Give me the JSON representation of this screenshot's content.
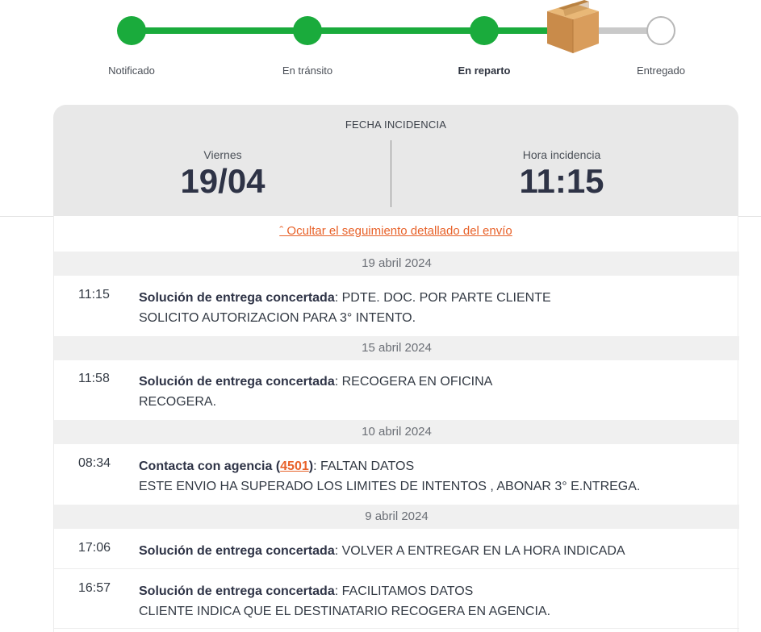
{
  "tracker": {
    "steps": [
      {
        "label": "Notificado",
        "state": "done"
      },
      {
        "label": "En tránsito",
        "state": "done"
      },
      {
        "label": "En reparto",
        "state": "current"
      },
      {
        "label": "Entregado",
        "state": "pending"
      }
    ],
    "accent": "#1aab3c",
    "icon": "package-box-icon"
  },
  "incident": {
    "title": "FECHA INCIDENCIA",
    "day_name": "Viernes",
    "date": "19/04",
    "time_label": "Hora incidencia",
    "time": "11:15"
  },
  "toggle_link": "ˆ Ocultar el seguimiento detallado del envío",
  "groups": [
    {
      "date": "19 abril 2024",
      "events": [
        {
          "time": "11:15",
          "title": "Solución de entrega concertada",
          "line1": ": PDTE. DOC. POR PARTE CLIENTE",
          "line2": "SOLICITO AUTORIZACION PARA 3° INTENTO."
        }
      ]
    },
    {
      "date": "15 abril 2024",
      "events": [
        {
          "time": "11:58",
          "title": "Solución de entrega concertada",
          "line1": ": RECOGERA EN OFICINA",
          "line2": "RECOGERA."
        }
      ]
    },
    {
      "date": "10 abril 2024",
      "events": [
        {
          "time": "08:34",
          "title_pre": "Contacta con agencia (",
          "agency": "4501",
          "title_post": ")",
          "line1": ": FALTAN DATOS",
          "line2": "ESTE ENVIO HA SUPERADO LOS LIMITES DE INTENTOS , ABONAR 3° E.NTREGA."
        }
      ]
    },
    {
      "date": "9 abril 2024",
      "events": [
        {
          "time": "17:06",
          "title": "Solución de entrega concertada",
          "line1": ": VOLVER A ENTREGAR EN LA HORA INDICADA"
        },
        {
          "time": "16:57",
          "title": "Solución de entrega concertada",
          "line1": ": FACILITAMOS DATOS",
          "line2": "CLIENTE INDICA QUE EL DESTINATARIO RECOGERA EN AGENCIA."
        }
      ]
    }
  ]
}
